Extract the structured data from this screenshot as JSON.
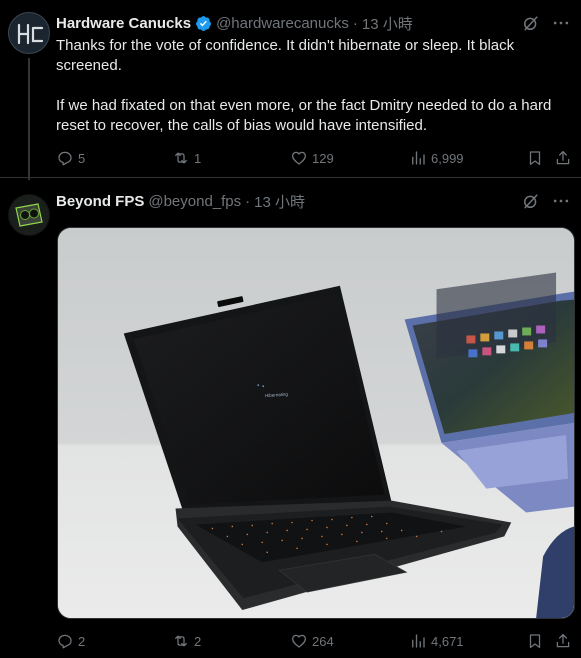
{
  "tweets": [
    {
      "author": "Hardware Canucks",
      "handle": "@hardwarecanucks",
      "separator": "·",
      "time": "13 小時",
      "verified": true,
      "text": [
        "Thanks for the vote of confidence.  It didn't hibernate or sleep.  It black screened.",
        "If we had fixated on that even more, or the fact Dmitry needed to do a hard reset to recover, the calls of bias would have intensified."
      ],
      "stats": {
        "replies": "5",
        "reposts": "1",
        "likes": "129",
        "views": "6,999"
      }
    },
    {
      "author": "Beyond FPS",
      "handle": "@beyond_fps",
      "separator": "·",
      "time": "13 小時",
      "verified": false,
      "media_screen_text": "Hibernating",
      "stats": {
        "replies": "2",
        "reposts": "2",
        "likes": "264",
        "views": "4,671"
      }
    }
  ],
  "colors": {
    "background": "#000000",
    "primary_text": "#e7e9ea",
    "secondary_text": "#71767b",
    "verified_blue": "#1d9bf0",
    "divider": "#2f3336"
  },
  "icons": [
    "verified-badge-icon",
    "grok-icon",
    "more-icon",
    "reply-icon",
    "retweet-icon",
    "like-icon",
    "views-icon",
    "bookmark-icon",
    "share-icon"
  ]
}
